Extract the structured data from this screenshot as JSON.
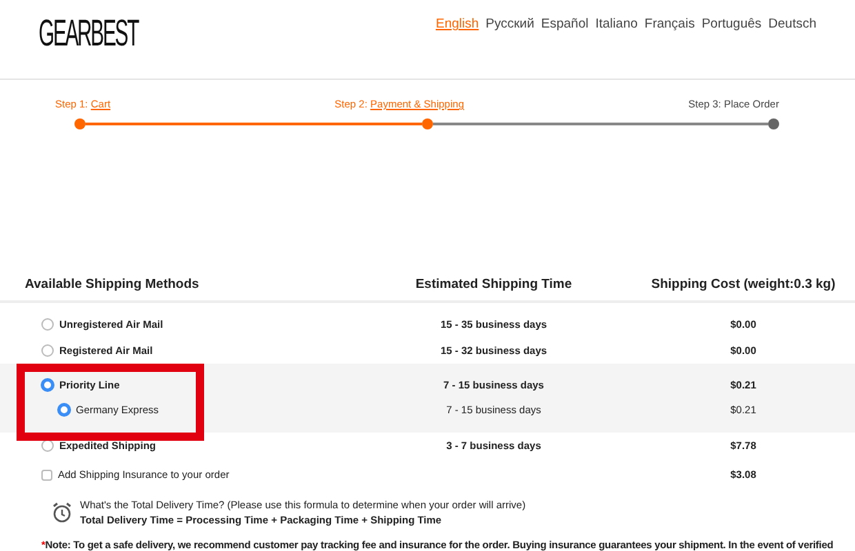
{
  "logo": "GEARBEST",
  "languages": [
    {
      "label": "English",
      "selected": true
    },
    {
      "label": "Русский",
      "selected": false
    },
    {
      "label": "Español",
      "selected": false
    },
    {
      "label": "Italiano",
      "selected": false
    },
    {
      "label": "Français",
      "selected": false
    },
    {
      "label": "Português",
      "selected": false
    },
    {
      "label": "Deutsch",
      "selected": false
    }
  ],
  "steps": [
    {
      "prefix": "Step 1:",
      "link": "Cart",
      "done": true
    },
    {
      "prefix": "Step 2:",
      "link": "Payment & Shipping",
      "done": true
    },
    {
      "prefix": "Step 3: Place Order",
      "done": false
    }
  ],
  "table": {
    "columns": [
      "Available Shipping Methods",
      "Estimated Shipping Time",
      "Shipping Cost (weight:0.3 kg)"
    ],
    "rows": [
      {
        "kind": "method",
        "label": "Unregistered Air Mail",
        "time": "15 - 35 business days",
        "cost": "$0.00",
        "selected": false
      },
      {
        "kind": "method",
        "label": "Registered Air Mail",
        "time": "15 - 32 business days",
        "cost": "$0.00",
        "selected": false
      },
      {
        "kind": "method",
        "label": "Priority Line",
        "time": "7 - 15 business days",
        "cost": "$0.21",
        "selected": true,
        "highlighted": true,
        "children": [
          {
            "label": "Germany Express",
            "time": "7 - 15 business days",
            "cost": "$0.21",
            "selected": true
          }
        ]
      },
      {
        "kind": "method",
        "label": "Expedited Shipping",
        "time": "3 - 7 business days",
        "cost": "$7.78",
        "selected": false
      },
      {
        "kind": "insurance",
        "label": "Add Shipping Insurance to your order",
        "cost": "$3.08",
        "checked": false
      }
    ]
  },
  "delivery_info": {
    "question": "What's the Total Delivery Time? (Please use this formula to determine when your order will arrive)",
    "formula": "Total Delivery Time = Processing Time + Packaging Time + Shipping Time"
  },
  "note": {
    "marker": "*",
    "text": "Note: To get a safe delivery, we recommend customer pay tracking fee and insurance for the order. Buying insurance guarantees your shipment. In the event of verified"
  }
}
